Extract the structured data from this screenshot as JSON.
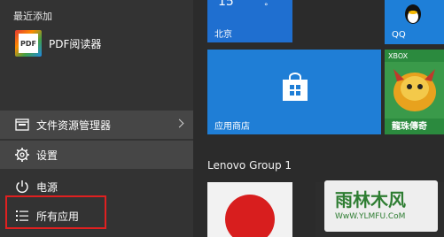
{
  "start_menu": {
    "section_header": "最近添加",
    "recent_app": {
      "icon_text": "PDF",
      "label": "PDF阅读器",
      "icon": "pdf-reader-icon"
    },
    "nav": [
      {
        "label": "文件资源管理器",
        "icon": "folder-icon",
        "has_chevron": true
      },
      {
        "label": "设置",
        "icon": "gear-icon"
      },
      {
        "label": "电源",
        "icon": "power-icon"
      },
      {
        "label": "所有应用",
        "icon": "list-icon"
      }
    ],
    "highlight_color": "#e02020"
  },
  "tiles": {
    "weather": {
      "temp": "15",
      "unit": "°",
      "city": "北京"
    },
    "qq": {
      "label": "QQ"
    },
    "store": {
      "label": "应用商店"
    },
    "game": {
      "badge": "XBOX",
      "label": "龍珠傳奇"
    },
    "group_title": "Lenovo Group 1"
  },
  "watermark": {
    "main": "雨林木风",
    "sub": "WwW.YLMFU.CoM"
  },
  "colors": {
    "tile_blue": "#1f7ed6",
    "menu_bg": "#333333",
    "bg": "#2b2b2b"
  }
}
